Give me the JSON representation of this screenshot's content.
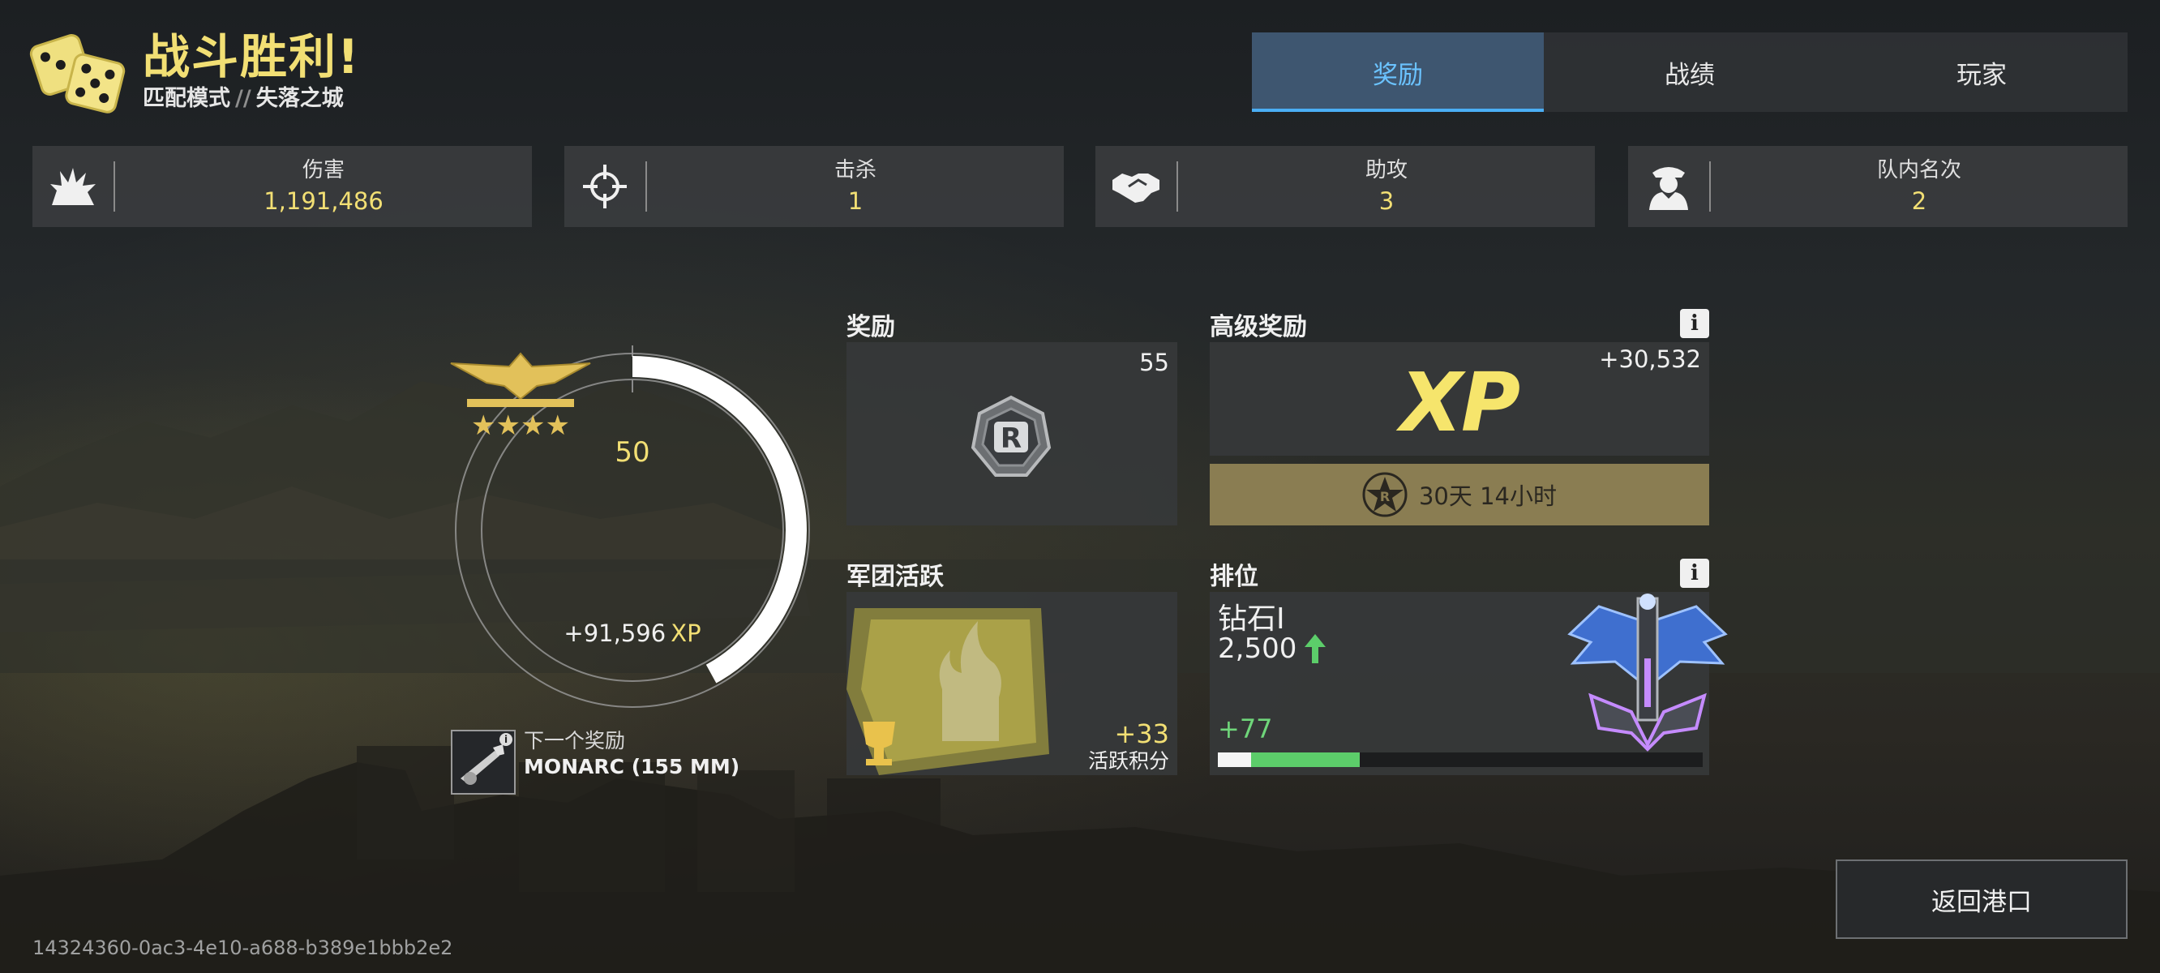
{
  "header": {
    "title": "战斗胜利!",
    "mode": "匹配模式",
    "separator": "//",
    "map": "失落之城"
  },
  "tabs": [
    {
      "label": "奖励",
      "active": true
    },
    {
      "label": "战绩",
      "active": false
    },
    {
      "label": "玩家",
      "active": false
    }
  ],
  "stats": [
    {
      "label": "伤害",
      "value": "1,191,486",
      "icon": "damage-explosion-icon"
    },
    {
      "label": "击杀",
      "value": "1",
      "icon": "crosshair-icon"
    },
    {
      "label": "助攻",
      "value": "3",
      "icon": "handshake-icon"
    },
    {
      "label": "队内名次",
      "value": "2",
      "icon": "commander-icon"
    }
  ],
  "progress": {
    "level": "50",
    "xp_gain": "+91,596",
    "xp_unit": "XP",
    "ring_fraction": 0.42,
    "next_reward_label": "下一个奖励",
    "next_reward_name": "MONARC (155 MM)"
  },
  "rewards": {
    "title": "奖励",
    "count": "55",
    "icon": "r-coin-icon"
  },
  "premium": {
    "title": "高级奖励",
    "xp_label": "XP",
    "xp_amount": "+30,532",
    "time_left": "30天 14小时"
  },
  "legion": {
    "title": "军团活跃",
    "points": "+33",
    "points_label": "活跃积分"
  },
  "ranking": {
    "title": "排位",
    "tier": "钻石I",
    "points": "2,500",
    "gain": "+77",
    "bar_base_fraction": 0.068,
    "bar_gain_fraction": 0.225
  },
  "buttons": {
    "return": "返回港口"
  },
  "match_id": "14324360-0ac3-4e10-a688-b389e1bbb2e2",
  "colors": {
    "gold": "#f2df74",
    "tab_active_text": "#6bc3ff",
    "tab_active_bg": "#3e5670",
    "rank_gain_green": "#5ccd6a"
  }
}
